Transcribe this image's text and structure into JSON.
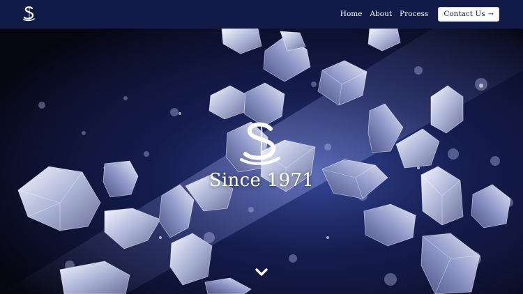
{
  "brand": {
    "logo_icon": "monogram-s-icon"
  },
  "nav": {
    "links": [
      "Home",
      "About",
      "Process"
    ],
    "contact_label": "Contact Us",
    "contact_icon": "arrow-right-icon"
  },
  "hero": {
    "tagline": "Since 1971",
    "logo_icon": "monogram-s-icon",
    "scroll_icon": "chevron-down-icon"
  },
  "colors": {
    "nav_background": "#121a47",
    "button_background": "#ffffff",
    "text": "#ffffff"
  }
}
